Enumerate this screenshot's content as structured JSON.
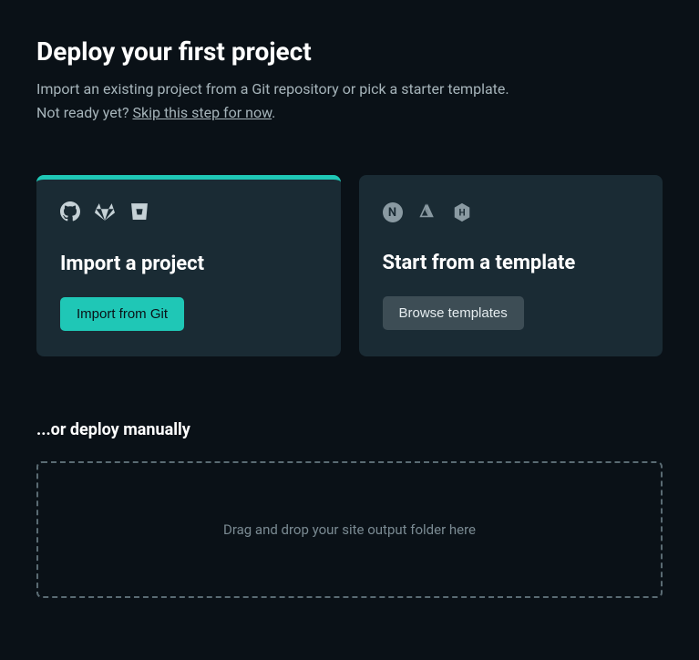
{
  "header": {
    "title": "Deploy your first project",
    "subtitle_line1": "Import an existing project from a Git repository or pick a starter template.",
    "subtitle_line2_prefix": "Not ready yet? ",
    "skip_link_text": "Skip this step for now",
    "subtitle_line2_suffix": "."
  },
  "cards": {
    "import": {
      "title": "Import a project",
      "button_label": "Import from Git",
      "icons": [
        "github",
        "gitlab",
        "bitbucket"
      ]
    },
    "template": {
      "title": "Start from a template",
      "button_label": "Browse templates",
      "icons": [
        "nextjs",
        "nuxt",
        "hugo"
      ]
    }
  },
  "manual": {
    "heading": "...or deploy manually",
    "dropzone_text": "Drag and drop your site output folder here"
  },
  "colors": {
    "accent": "#1fc7b6",
    "card_bg": "#1a2b34",
    "page_bg": "#0a1117"
  }
}
